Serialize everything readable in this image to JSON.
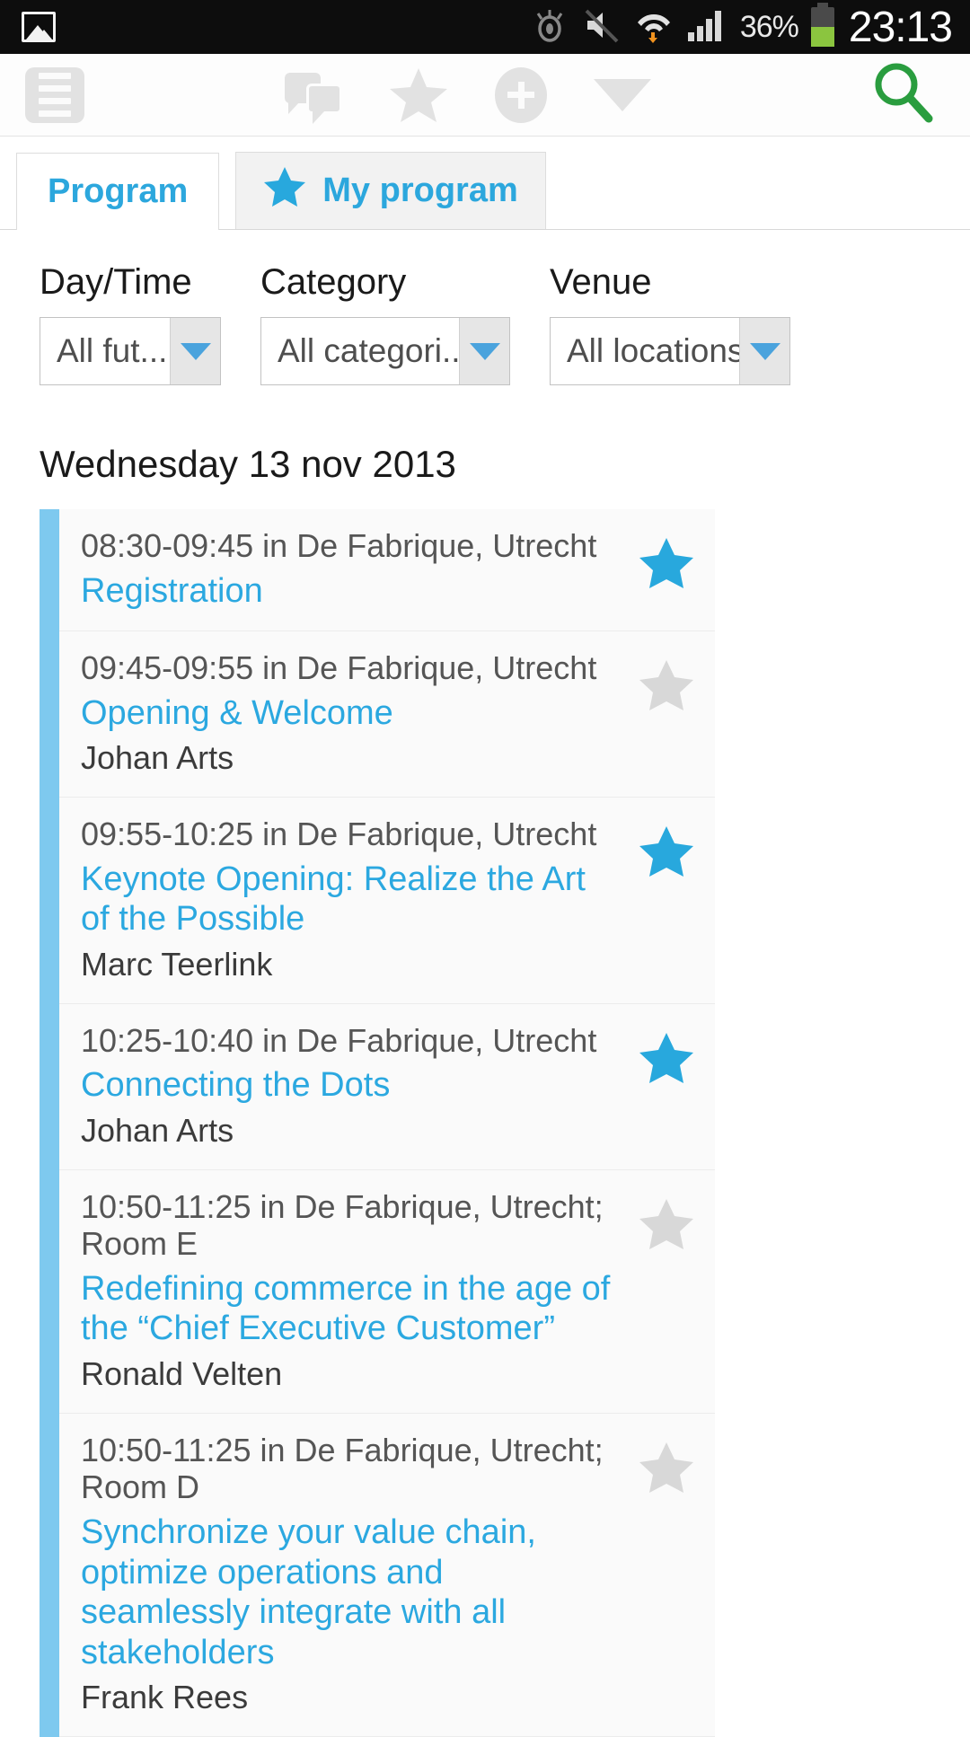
{
  "status_bar": {
    "left_icon": "photo-icon",
    "icons": [
      "eye-icon",
      "mute-icon",
      "wifi-icon",
      "signal-icon"
    ],
    "battery_percent": "36%",
    "clock": "23:13"
  },
  "toolbar": {
    "menu_icon": "hamburger-menu-icon",
    "chat_icon": "chat-bubbles-icon",
    "star_icon": "star-icon",
    "add_icon": "plus-circle-icon",
    "filter_icon": "funnel-filter-icon",
    "search_icon": "search-icon",
    "accent_green": "#2a9d3f"
  },
  "tabs": [
    {
      "label": "Program",
      "active": true,
      "icon": null
    },
    {
      "label": "My program",
      "active": false,
      "icon": "star-icon"
    }
  ],
  "filters": [
    {
      "label": "Day/Time",
      "value": "All fut..."
    },
    {
      "label": "Category",
      "value": "All categori..."
    },
    {
      "label": "Venue",
      "value": "All locations"
    }
  ],
  "date_heading": "Wednesday 13 nov 2013",
  "colors": {
    "link_blue": "#2ba8e0",
    "star_blue": "#28a8dd",
    "star_gray": "#d8d8d8",
    "rail_blue": "#7ec9ef"
  },
  "program": [
    {
      "meta": "08:30-09:45 in De Fabrique, Utrecht",
      "title": "Registration",
      "speaker": "",
      "starred": true
    },
    {
      "meta": "09:45-09:55 in De Fabrique, Utrecht",
      "title": "Opening & Welcome",
      "speaker": "Johan Arts",
      "starred": false
    },
    {
      "meta": "09:55-10:25 in De Fabrique, Utrecht",
      "title": "Keynote Opening: Realize the Art of the Possible",
      "speaker": "Marc Teerlink",
      "starred": true
    },
    {
      "meta": "10:25-10:40 in De Fabrique, Utrecht",
      "title": "Connecting the Dots",
      "speaker": "Johan Arts",
      "starred": true
    },
    {
      "meta": "10:50-11:25 in De Fabrique, Utrecht; Room E",
      "title": "Redefining commerce in the age of the “Chief Executive Customer”",
      "speaker": "Ronald Velten",
      "starred": false
    },
    {
      "meta": "10:50-11:25 in De Fabrique, Utrecht; Room D",
      "title": "Synchronize your value chain, optimize operations and seamlessly integrate with all stakeholders",
      "speaker": "Frank Rees",
      "starred": false
    }
  ]
}
